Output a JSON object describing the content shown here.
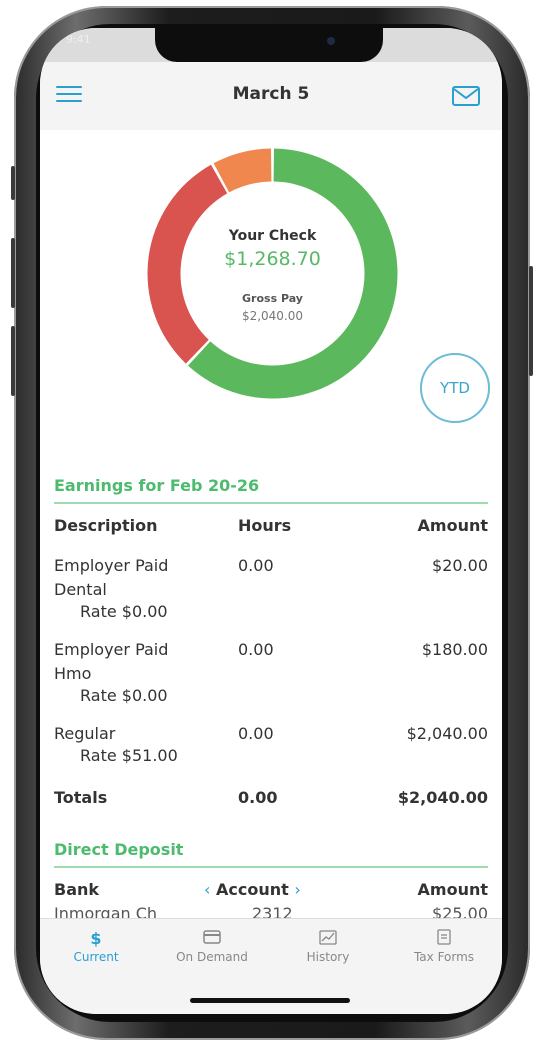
{
  "header": {
    "title": "March 5"
  },
  "summary": {
    "check_label": "Your Check",
    "check_amount": "$1,268.70",
    "gross_label": "Gross Pay",
    "gross_amount": "$2,040.00",
    "ytd_label": "YTD",
    "segments": [
      {
        "label": "Your Check",
        "fraction": 0.62,
        "color": "#5cb85c"
      },
      {
        "label": "segment-2",
        "fraction": 0.3,
        "color": "#d9534f"
      },
      {
        "label": "segment-3",
        "fraction": 0.08,
        "color": "#f0874f"
      }
    ]
  },
  "earnings": {
    "title": "Earnings for Feb 20-26",
    "headers": [
      "Description",
      "Hours",
      "Amount"
    ],
    "rows": [
      {
        "desc1": "Employer Paid",
        "desc2": "Dental",
        "rate": "Rate $0.00",
        "hours": "0.00",
        "amount": "$20.00"
      },
      {
        "desc1": "Employer Paid",
        "desc2": "Hmo",
        "rate": "Rate $0.00",
        "hours": "0.00",
        "amount": "$180.00"
      },
      {
        "desc1": "Regular",
        "desc2": "",
        "rate": "Rate $51.00",
        "hours": "0.00",
        "amount": "$2,040.00"
      }
    ],
    "totals": {
      "label": "Totals",
      "hours": "0.00",
      "amount": "$2,040.00"
    }
  },
  "deposit": {
    "title": "Direct Deposit",
    "headers": {
      "bank": "Bank",
      "account": "Account",
      "amount": "Amount"
    },
    "rows": [
      {
        "bank": "Inmorgan Ch",
        "account": "2312",
        "amount": "$25.00"
      }
    ]
  },
  "tabs": [
    {
      "label": "Current",
      "icon": "dollar-icon",
      "active": true
    },
    {
      "label": "On Demand",
      "icon": "card-icon",
      "active": false
    },
    {
      "label": "History",
      "icon": "history-icon",
      "active": false
    },
    {
      "label": "Tax Forms",
      "icon": "tax-form-icon",
      "active": false
    }
  ]
}
